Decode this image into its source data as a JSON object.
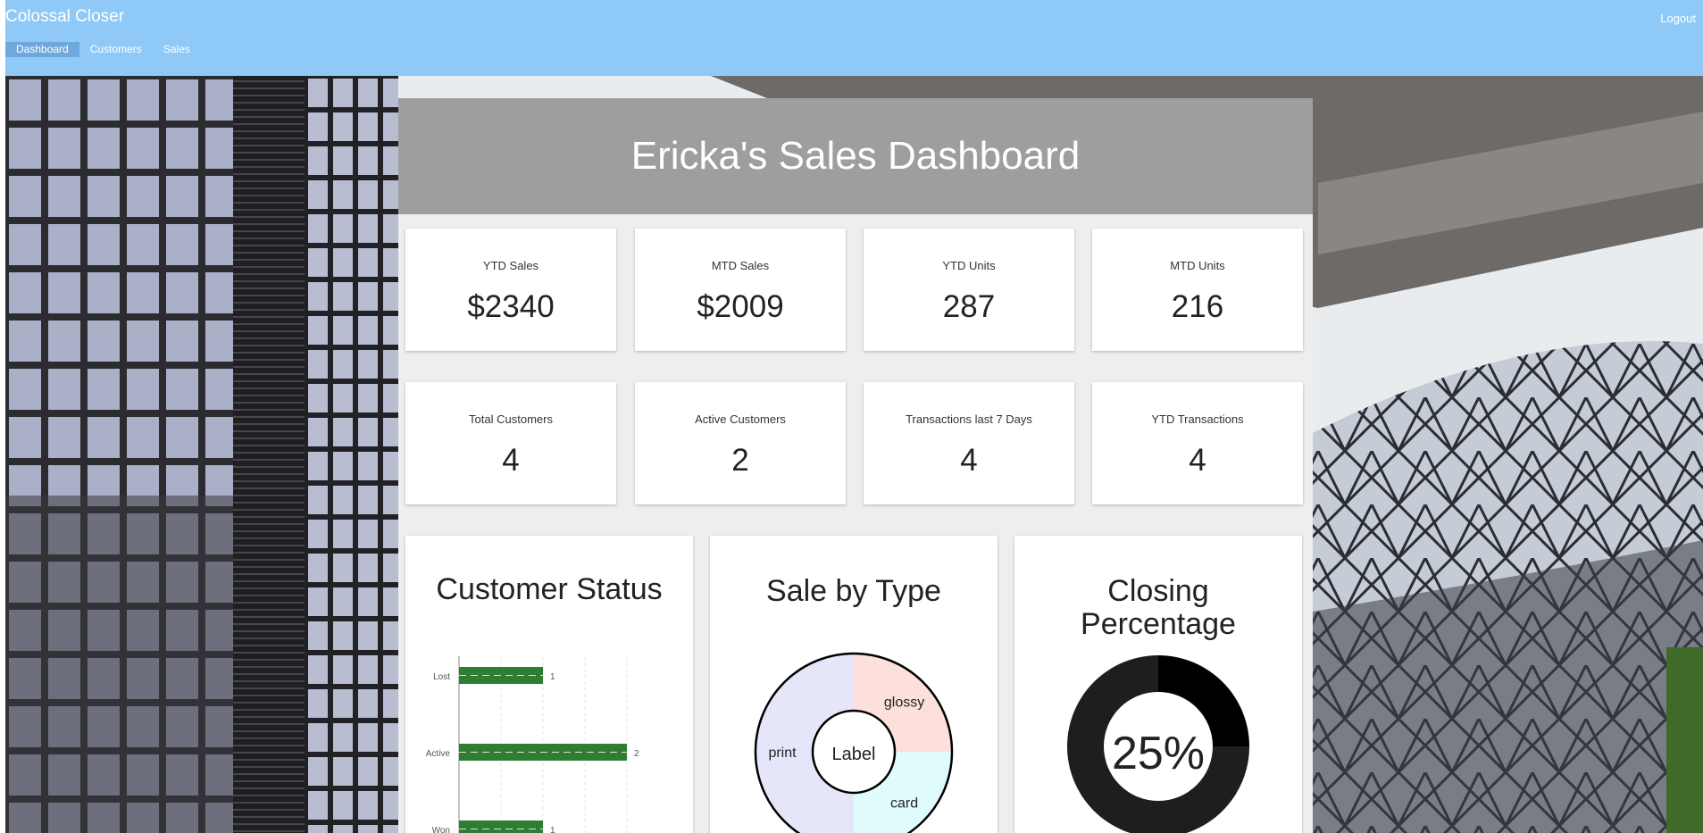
{
  "app": {
    "title": "Colossal Closer",
    "logout_label": "Logout"
  },
  "nav": {
    "items": [
      "Dashboard",
      "Customers",
      "Sales"
    ],
    "active": "Dashboard"
  },
  "dashboard": {
    "title": "Ericka's Sales Dashboard",
    "stats_row1": [
      {
        "label": "YTD Sales",
        "value": "$2340"
      },
      {
        "label": "MTD Sales",
        "value": "$2009"
      },
      {
        "label": "YTD Units",
        "value": "287"
      },
      {
        "label": "MTD Units",
        "value": "216"
      }
    ],
    "stats_row2": [
      {
        "label": "Total Customers",
        "value": "4"
      },
      {
        "label": "Active Customers",
        "value": "2"
      },
      {
        "label": "Transactions last 7 Days",
        "value": "4"
      },
      {
        "label": "YTD Transactions",
        "value": "4"
      }
    ]
  },
  "charts": {
    "customer_status_title": "Customer Status",
    "sale_by_type_title": "Sale by Type",
    "closing_title_line1": "Closing",
    "closing_title_line2": "Percentage",
    "donut_center_label": "Label",
    "closing_value_text": "25%"
  },
  "chart_data": [
    {
      "type": "bar",
      "orientation": "horizontal",
      "title": "Customer Status",
      "categories": [
        "Lost",
        "Active",
        "Won"
      ],
      "values": [
        1,
        2,
        1
      ],
      "color": "#2e7d32"
    },
    {
      "type": "pie",
      "title": "Sale by Type",
      "labels": [
        "glossy",
        "card",
        "print"
      ],
      "values": [
        1,
        1,
        2
      ],
      "colors": [
        "#fde0dc",
        "#e0fbfc",
        "#e6e6fa"
      ],
      "center_label": "Label"
    },
    {
      "type": "pie",
      "title": "Closing Percentage",
      "values": [
        25,
        75
      ],
      "display": "25%",
      "colors": [
        "#000000",
        "#1e1e1e"
      ]
    }
  ],
  "colors": {
    "topbar": "#8fc9f7",
    "header": "#9e9e9e",
    "bar": "#2e7d32"
  }
}
